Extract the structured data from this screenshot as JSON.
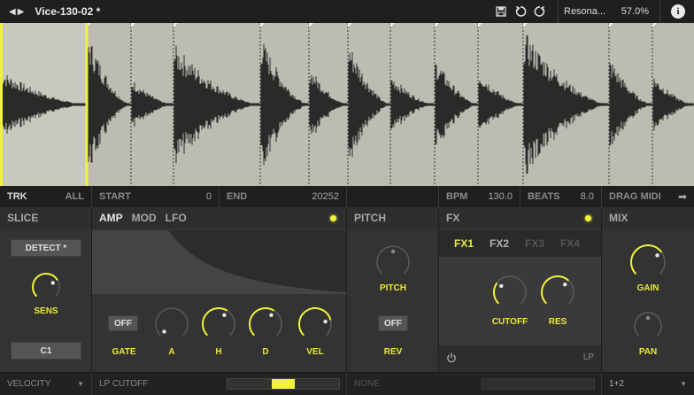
{
  "header": {
    "preset_name": "Vice-130-02 *",
    "plugin_name": "Resona...",
    "cpu_percent": "57.0%",
    "icons": [
      "prev-arrow-icon",
      "next-arrow-icon",
      "save-icon",
      "undo-icon",
      "redo-icon",
      "info-icon"
    ]
  },
  "infobar": {
    "trk": "TRK",
    "all": "ALL",
    "start_label": "START",
    "start_value": "0",
    "end_label": "END",
    "end_value": "20252",
    "bpm_label": "BPM",
    "bpm_value": "130.0",
    "beats_label": "BEATS",
    "beats_value": "8.0",
    "drag_midi": "DRAG MIDI"
  },
  "slice": {
    "title": "SLICE",
    "detect_label": "DETECT *",
    "sens_label": "SENS",
    "sens_value": 0.72,
    "note_label": "C1"
  },
  "amp": {
    "tabs": [
      "AMP",
      "MOD",
      "LFO"
    ],
    "gate_button": "OFF",
    "gate_label": "GATE",
    "knobs": [
      {
        "label": "A",
        "value": 0.0
      },
      {
        "label": "H",
        "value": 0.62
      },
      {
        "label": "D",
        "value": 0.62
      },
      {
        "label": "VEL",
        "value": 0.78
      }
    ]
  },
  "pitch": {
    "title": "PITCH",
    "pitch_label": "PITCH",
    "pitch_value": 0.5,
    "rev_button": "OFF",
    "rev_label": "REV"
  },
  "fx": {
    "title": "FX",
    "tabs": [
      "FX1",
      "FX2",
      "FX3",
      "FX4"
    ],
    "cutoff_label": "CUTOFF",
    "cutoff_value": 0.3,
    "res_label": "RES",
    "res_value": 0.66,
    "mode": "LP"
  },
  "mix": {
    "title": "MIX",
    "gain_label": "GAIN",
    "gain_value": 0.7,
    "pan_label": "PAN",
    "pan_value": 0.5
  },
  "footer": {
    "velocity": "VELOCITY",
    "lpcutoff": "LP CUTOFF",
    "lp_amount": 0.5,
    "none": "NONE",
    "output": "1+2"
  },
  "colors": {
    "accent": "#f2f23a",
    "waveform_bg": "#bdbcb2",
    "waveform_fill": "#2a2a28",
    "selected_slice": "#c9c8bf"
  }
}
